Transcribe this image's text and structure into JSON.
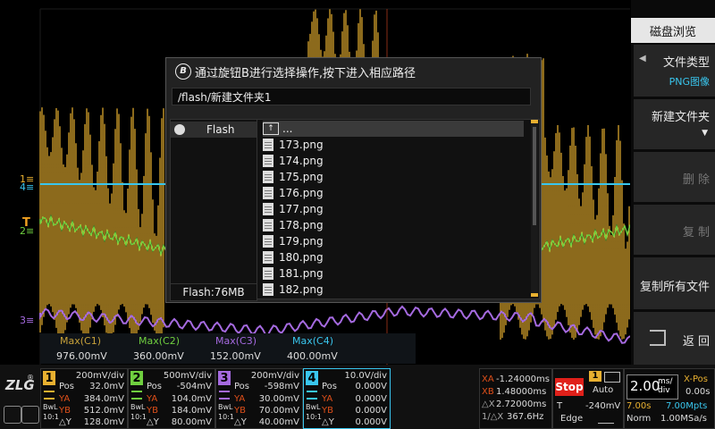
{
  "menu": {
    "title": "磁盘浏览",
    "file_type_label": "文件类型",
    "file_type_value": "PNG图像",
    "new_folder": "新建文件夹",
    "delete": "删 除",
    "copy": "复 制",
    "copy_all": "复制所有文件",
    "back": "返 回"
  },
  "dialog": {
    "title": "通过旋钮B进行选择操作,按下进入相应路径",
    "knob_badge": "B",
    "path": "/flash/新建文件夹1",
    "drive_label": "Flash",
    "drive_size": "Flash:76MB",
    "parent_entry": "...",
    "files": [
      "173.png",
      "174.png",
      "175.png",
      "176.png",
      "177.png",
      "178.png",
      "179.png",
      "180.png",
      "181.png",
      "182.png"
    ]
  },
  "markers": {
    "ch1": "1",
    "ch4": "4",
    "trigger": "T",
    "ch2": "2",
    "ch3": "3"
  },
  "measure": {
    "headers": [
      "Max(C1)",
      "Max(C2)",
      "Max(C3)",
      "Max(C4)"
    ],
    "values": [
      "976.00mV",
      "360.00mV",
      "152.00mV",
      "400.00mV"
    ]
  },
  "channels": [
    {
      "num": "1",
      "color": "#e8b030",
      "div": "200mV/div",
      "pos": "32.0mV",
      "ya": "384.0mV",
      "yb": "512.0mV",
      "dy": "128.0mV"
    },
    {
      "num": "2",
      "color": "#6fcf3f",
      "div": "500mV/div",
      "pos": "-504mV",
      "ya": "104.0mV",
      "yb": "184.0mV",
      "dy": "80.00mV"
    },
    {
      "num": "3",
      "color": "#a56ae0",
      "div": "200mV/div",
      "pos": "-598mV",
      "ya": "30.00mV",
      "yb": "70.00mV",
      "dy": "40.00mV"
    },
    {
      "num": "4",
      "color": "#39c6ee",
      "div": "10.0V/div",
      "pos": "0.000V",
      "ya": "0.000V",
      "yb": "0.000V",
      "dy": "0.000V"
    }
  ],
  "labels": {
    "pos": "Pos",
    "ya": "YA",
    "yb": "YB",
    "dy": "△Y",
    "bwl": "BwL",
    "ratio": "10:1",
    "logo": "ZLG"
  },
  "cursor": {
    "xa_label": "XA",
    "xa": "-1.24000ms",
    "xb_label": "XB",
    "xb": "1.48000ms",
    "dx_label": "△X",
    "dx": "2.72000ms",
    "inv_label": "1/△X",
    "inv": "367.6Hz"
  },
  "trigger": {
    "state": "Stop",
    "source": "1",
    "mode": "Auto",
    "t_label": "T",
    "level": "-240mV",
    "edge_label": "Edge"
  },
  "timebase": {
    "value": "2.00",
    "unit": "ms/\ndiv",
    "xpos_label": "X-Pos",
    "xpos": "0.00s",
    "window": "7.00s",
    "mpts": "7.00Mpts",
    "norm": "Norm",
    "rate": "1.00MSa/s"
  },
  "colors": {
    "ch1": "#e8b030",
    "ch2": "#6fcf3f",
    "ch3": "#a56ae0",
    "ch4": "#39c6ee",
    "trigger": "#f0a020",
    "stop": "#e0201a"
  }
}
